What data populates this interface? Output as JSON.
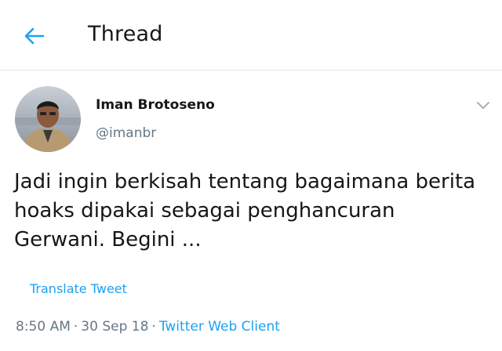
{
  "header": {
    "title": "Thread",
    "back_icon": "arrow-left-icon",
    "accent_color": "#1da1f2"
  },
  "tweet": {
    "author_name": "Iman Brotoseno",
    "author_handle": "@imanbr",
    "menu_icon": "chevron-down-icon",
    "text": "Jadi ingin berkisah tentang bagaimana berita hoaks dipakai sebagai penghancuran Gerwani. Begini ...",
    "translate_label": "Translate Tweet",
    "time": "8:50 AM",
    "separator": "·",
    "date": "30 Sep 18",
    "client": "Twitter Web Client"
  }
}
